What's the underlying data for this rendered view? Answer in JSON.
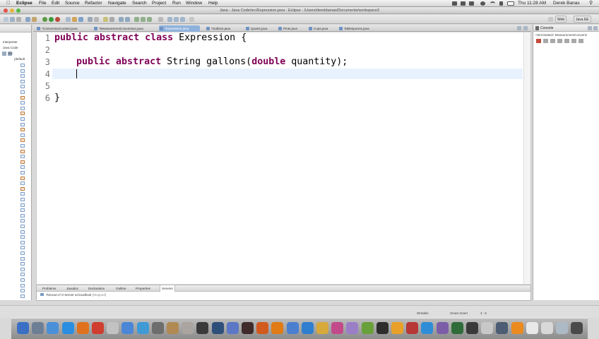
{
  "menubar": {
    "app": "Eclipse",
    "items": [
      "File",
      "Edit",
      "Source",
      "Refactor",
      "Navigate",
      "Search",
      "Project",
      "Run",
      "Window",
      "Help"
    ],
    "clock": "Thu 11:28 AM",
    "user": "Derek Banas"
  },
  "window": {
    "title": "Java - Java Code/src/Expression.java - Eclipse - /Users/derekbanas/Documents/workspace3"
  },
  "toolbar": {
    "perspective_web": "Web",
    "perspective_java": "Java EE"
  },
  "tabs": [
    {
      "label": "*ConversionContext.java",
      "active": false
    },
    {
      "label": "*MeasurementConversion.java",
      "active": false
    },
    {
      "label": "*Expression.java",
      "active": true
    },
    {
      "label": "*Gallons.java",
      "active": false
    },
    {
      "label": "Quarts.java",
      "active": false
    },
    {
      "label": "Pints.java",
      "active": false
    },
    {
      "label": "Cups.java",
      "active": false
    },
    {
      "label": "Tablespoons.java",
      "active": false
    }
  ],
  "explorer": {
    "rows": [
      "Interpreter",
      "Java Code",
      "src",
      "(default"
    ]
  },
  "editor": {
    "line_numbers": [
      "1",
      "2",
      "3",
      "4",
      "5",
      "6"
    ],
    "line1": {
      "kw": "public abstract class",
      "text": " Expression {"
    },
    "line3": {
      "kw1": "public abstract",
      "mid": " String gallons(",
      "kw2": "double",
      "end": " quantity);"
    },
    "line6": {
      "text": "}"
    }
  },
  "console": {
    "title": "Console",
    "subtitle": "<terminated> MeasurementConversi"
  },
  "bottom_panel": {
    "tabs": [
      "Problems",
      "Javadoc",
      "Declaration",
      "Outline",
      "Properties",
      "Servers"
    ],
    "active": "Servers",
    "server_name": "Tomcat v7.0 Server at localhost",
    "server_state": "[Stopped]"
  },
  "statusbar": {
    "writable": "Writable",
    "insert_mode": "Smart Insert",
    "position": "4 : 5"
  },
  "colors": {
    "keyword": "#7f0055",
    "current_line": "#e8f2fe",
    "active_tab": "#8fb2dc"
  }
}
